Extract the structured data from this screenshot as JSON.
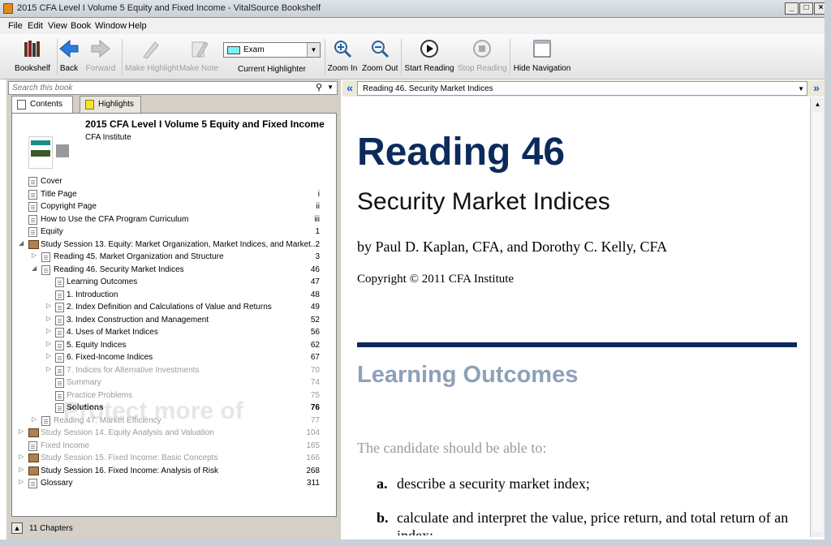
{
  "window": {
    "title": "2015 CFA Level I Volume 5 Equity and Fixed Income - VitalSource Bookshelf"
  },
  "menu": [
    "File",
    "Edit",
    "View",
    "Book",
    "Window",
    "Help"
  ],
  "toolbar": {
    "bookshelf": "Bookshelf",
    "back": "Back",
    "forward": "Forward",
    "make_highlight": "Make Highlight",
    "make_note": "Make Note",
    "highlighter_value": "Exam",
    "highlighter_caption": "Current Highlighter",
    "zoom_in": "Zoom In",
    "zoom_out": "Zoom Out",
    "start_reading": "Start Reading",
    "stop_reading": "Stop Reading",
    "hide_navigation": "Hide Navigation",
    "highlighter_color": "#7ff1f1"
  },
  "search": {
    "placeholder": "Search this book"
  },
  "tabs": {
    "contents": "Contents",
    "highlights": "Highlights"
  },
  "book": {
    "title": "2015 CFA Level I Volume 5 Equity and Fixed Income",
    "author": "CFA Institute"
  },
  "toc": [
    {
      "label": "Cover",
      "page": ""
    },
    {
      "label": "Title Page",
      "page": "i"
    },
    {
      "label": "Copyright Page",
      "page": "ii"
    },
    {
      "label": "How to Use the CFA Program Curriculum",
      "page": "iii"
    },
    {
      "label": "Equity",
      "page": "1"
    },
    {
      "label": "Study Session 13. Equity: Market Organization, Market Indices, and Market...",
      "page": "2"
    },
    {
      "label": "Reading 45. Market Organization and Structure",
      "page": "3"
    },
    {
      "label": "Reading 46. Security Market Indices",
      "page": "46"
    },
    {
      "label": "Learning Outcomes",
      "page": "47"
    },
    {
      "label": "1. Introduction",
      "page": "48"
    },
    {
      "label": "2. Index Definition and Calculations of Value and Returns",
      "page": "49"
    },
    {
      "label": "3. Index Construction and Management",
      "page": "52"
    },
    {
      "label": "4. Uses of Market Indices",
      "page": "56"
    },
    {
      "label": "5. Equity Indices",
      "page": "62"
    },
    {
      "label": "6. Fixed-Income Indices",
      "page": "67"
    },
    {
      "label": "7. Indices for Alternative Investments",
      "page": "70"
    },
    {
      "label": "Summary",
      "page": "74"
    },
    {
      "label": "Practice Problems",
      "page": "75"
    },
    {
      "label": "Solutions",
      "page": "76"
    },
    {
      "label": "Reading 47. Market Efficiency",
      "page": "77"
    },
    {
      "label": "Study Session 14. Equity Analysis and Valuation",
      "page": "104"
    },
    {
      "label": "Fixed Income",
      "page": "165"
    },
    {
      "label": "Study Session 15. Fixed Income: Basic Concepts",
      "page": "166"
    },
    {
      "label": "Study Session 16. Fixed Income: Analysis of Risk",
      "page": "268"
    },
    {
      "label": "Glossary",
      "page": "311"
    }
  ],
  "watermark": "Protect more of",
  "status": {
    "chapters": "11 Chapters"
  },
  "navigation": {
    "current_location": "Reading 46. Security Market Indices"
  },
  "content": {
    "heading": "Reading 46",
    "subtitle": "Security Market Indices",
    "byline": "by Paul D. Kaplan, CFA, and Dorothy C. Kelly, CFA",
    "copyright": "Copyright © 2011 CFA Institute",
    "section_heading": "Learning Outcomes",
    "intro": "The candidate should be able to:",
    "objectives": [
      {
        "letter": "a.",
        "text": "describe a security market index;"
      },
      {
        "letter": "b.",
        "text": "calculate and interpret the value, price return, and total return of an index;"
      }
    ]
  }
}
